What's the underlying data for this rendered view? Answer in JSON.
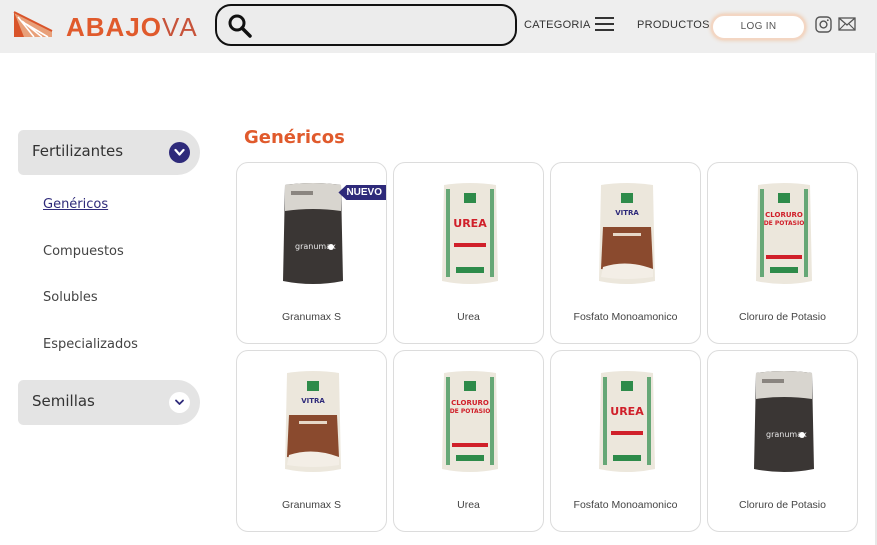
{
  "header": {
    "logo_bold": "ABAJO",
    "logo_light": "VA",
    "search_placeholder": "",
    "nav_categoria": "CATEGORIA",
    "nav_productos": "PRODUCTOS",
    "login_label": "LOG IN"
  },
  "sidebar": {
    "categories": [
      {
        "label": "Fertilizantes",
        "expanded": true
      },
      {
        "label": "Semillas",
        "expanded": false
      }
    ],
    "subitems": [
      "Genéricos",
      "Compuestos",
      "Solubles",
      "Especializados"
    ],
    "active_subitem": "Genéricos"
  },
  "main": {
    "title": "Genéricos",
    "badge": "NUEVO",
    "products": [
      {
        "name": "Granumax S",
        "bag": "dark"
      },
      {
        "name": "Urea",
        "bag": "urea"
      },
      {
        "name": "Fosfato Monoamonico",
        "bag": "vitra"
      },
      {
        "name": "Cloruro de Potasio",
        "bag": "cloruro"
      },
      {
        "name": "Granumax S",
        "bag": "vitra"
      },
      {
        "name": "Urea",
        "bag": "cloruro"
      },
      {
        "name": "Fosfato Monoamonico",
        "bag": "urea"
      },
      {
        "name": "Cloruro de Potasio",
        "bag": "dark"
      }
    ]
  },
  "colors": {
    "accent": "#e05a2c",
    "brand_dark": "#2e2a7a",
    "header_bg": "#eeeeee"
  }
}
